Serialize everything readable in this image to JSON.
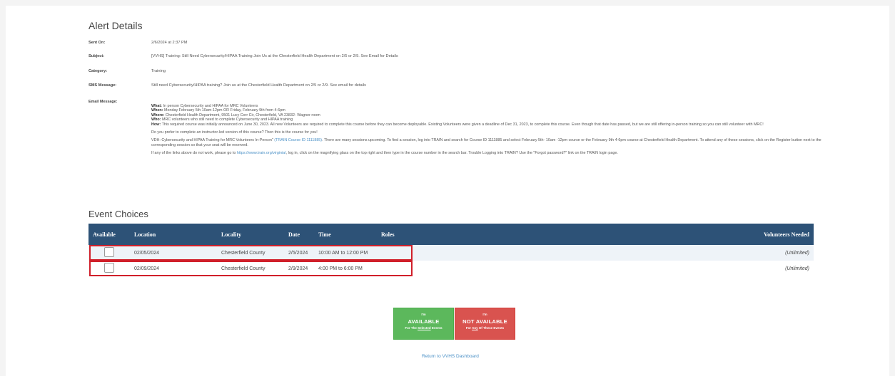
{
  "alert": {
    "heading": "Alert Details",
    "sent_on_label": "Sent On:",
    "sent_on": "2/6/2024 at 2:37 PM",
    "subject_label": "Subject:",
    "subject": "[VVHS] Training: Still Need Cybersecurity/HIPAA Training Join Us at the Chesterfield Health Department on 2/5 or 2/9. See Email for Details",
    "category_label": "Category:",
    "category": "Training",
    "sms_label": "SMS Message:",
    "sms": "Still need Cybersecurity/HIPAA training? Join us at the Chesterfield Health Department on 2/5 or 2/9. See email for details",
    "email_label": "Email Message:",
    "email": {
      "what_label": "What:",
      "what": " In person Cybersecurity and HIPAA for MRC Volunteers",
      "when_label": "When:",
      "when": "  Monday February 5th 10am-12pm OR  Friday, February 9th from 4-6pm",
      "where_label": "Where:",
      "where": " Chesterfield Health Department, 9501 Lucy Corr Cir, Chesterfield, VA 23832- Wagner room",
      "who_label": "Who:",
      "who": " MRC volunteers who still need to complete Cybersecurity and HIPAA training",
      "how_label": "How:",
      "how": " This required course was initially announced on June 30, 2023.  All new Volunteers are required to complete this course before they can become deployable.  Existing Volunteers were given a deadline of Dec 31, 2023, to complete this course.  Even though that date has passed, but we are still offering in-person training so you can still volunteer with MRC!",
      "para2": "Do you prefer to complete an instructor-led version of this course? Then this is the course for you!",
      "para3_a": "VDH: Cybersecurity and HIPAA Training for MRC Volunteers In-Person\" ",
      "para3_link": "(TRAIN Course ID 1111885)",
      "para3_b": ". There are many sessions upcoming. To find a session, log into TRAIN and search for Course ID 1111885 and select February 5th- 10am -12pm course  or the February 9th 4-6pm course at Chesterfield Health Department.  To attend any of these sessions, click on the Register button next to the corresponding session so that your seat will be reserved.",
      "para4_a": "If any of the links above do not work, please go to ",
      "para4_link": "https://www.train.org/virginia/",
      "para4_b": ", log in, click on the magnifying glass on the top right and then type in the course number in the search bar.  Trouble Logging into TRAIN?  Use the \"Forgot password?\" link on the TRAIN login page."
    }
  },
  "events": {
    "heading": "Event Choices",
    "columns": [
      "Available",
      "Location",
      "Locality",
      "Date",
      "Time",
      "Roles",
      "Volunteers Needed"
    ],
    "rows": [
      {
        "location": "02/05/2024",
        "locality": "Chesterfield County",
        "date": "2/5/2024",
        "time": "10:00 AM to 12:00 PM",
        "roles": "",
        "needed": "(Unlimited)"
      },
      {
        "location": "02/09/2024",
        "locality": "Chesterfield County",
        "date": "2/9/2024",
        "time": "4:00 PM to 6:00 PM",
        "roles": "",
        "needed": "(Unlimited)"
      }
    ]
  },
  "buttons": {
    "available_top": "I'm",
    "available_main": "AVAILABLE",
    "available_sub_a": "For The ",
    "available_sub_u": "Selected",
    "available_sub_b": " Events",
    "not_top": "I'm",
    "not_main": "NOT AVAILABLE",
    "not_sub_a": "For ",
    "not_sub_u": "Any",
    "not_sub_b": " Of These Events"
  },
  "return_link": "Return to VVHS Dashboard",
  "colors": {
    "header": "#2d5277",
    "green": "#5cb85c",
    "red": "#d9534f",
    "highlight": "#d01f2a"
  }
}
